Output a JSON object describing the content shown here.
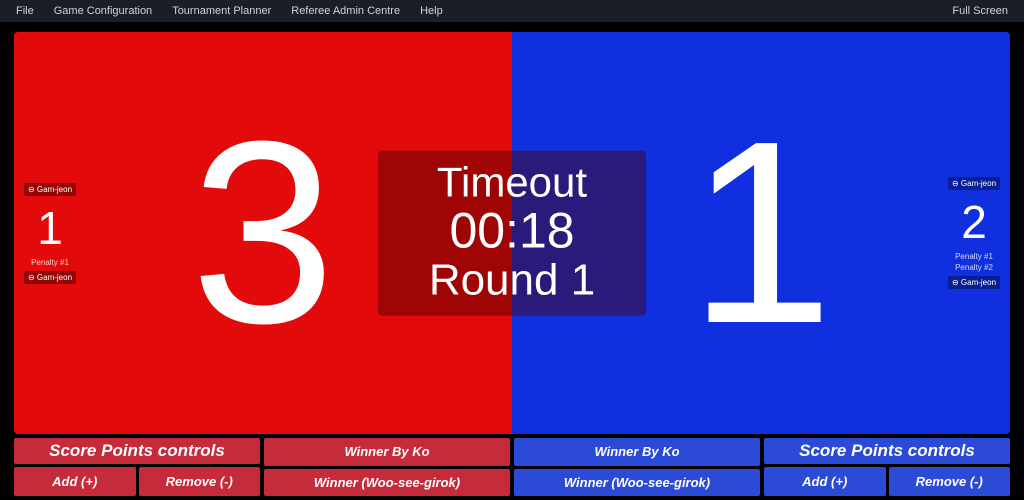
{
  "menu": {
    "file": "File",
    "game_config": "Game Configuration",
    "tournament": "Tournament Planner",
    "referee": "Referee Admin Centre",
    "help": "Help",
    "fullscreen": "Full Screen"
  },
  "center": {
    "timeout_label": "Timeout",
    "time": "00:18",
    "round_label": "Round 1"
  },
  "red": {
    "score": "3",
    "penalty_count": "1",
    "gam_label": "⊖ Gam-jeon",
    "penalty_item": "Penalty #1"
  },
  "blue": {
    "score": "1",
    "penalty_count": "2",
    "gam_label": "⊖ Gam-jeon",
    "penalty_item1": "Penalty #1",
    "penalty_item2": "Penalty #2"
  },
  "controls": {
    "header": "Score Points controls",
    "add": "Add (+)",
    "remove": "Remove (-)",
    "winner_ko": "Winner By Ko",
    "winner_woo": "Winner (Woo-see-girok)"
  }
}
